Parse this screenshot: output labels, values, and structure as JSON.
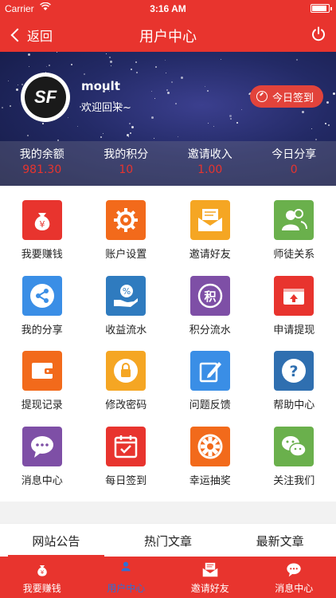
{
  "status": {
    "carrier": "Carrier",
    "time": "3:16 AM",
    "battery_level": 0.9
  },
  "nav": {
    "back_label": "返回",
    "title": "用户中心"
  },
  "profile": {
    "avatar_text": "SF",
    "username": "moult",
    "welcome": "欢迎回来~",
    "checkin_label": "今日签到"
  },
  "stats": [
    {
      "label": "我的余额",
      "value": "981.30"
    },
    {
      "label": "我的积分",
      "value": "10"
    },
    {
      "label": "邀请收入",
      "value": "1.00"
    },
    {
      "label": "今日分享",
      "value": "0"
    }
  ],
  "grid": [
    {
      "label": "我要赚钱",
      "icon": "money-bag-icon",
      "color": "#e8342e"
    },
    {
      "label": "账户设置",
      "icon": "gear-icon",
      "color": "#f26a1b"
    },
    {
      "label": "邀请好友",
      "icon": "envelope-icon",
      "color": "#f5a623"
    },
    {
      "label": "师徒关系",
      "icon": "users-icon",
      "color": "#6ab04c"
    },
    {
      "label": "我的分享",
      "icon": "share-icon",
      "color": "#3a8ee6"
    },
    {
      "label": "收益流水",
      "icon": "percent-hand-icon",
      "color": "#2f7bbf"
    },
    {
      "label": "积分流水",
      "icon": "points-icon",
      "color": "#7e4fa6"
    },
    {
      "label": "申请提现",
      "icon": "wallet-up-icon",
      "color": "#e8342e"
    },
    {
      "label": "提现记录",
      "icon": "wallet-icon",
      "color": "#f26a1b"
    },
    {
      "label": "修改密码",
      "icon": "lock-icon",
      "color": "#f5a623"
    },
    {
      "label": "问题反馈",
      "icon": "edit-icon",
      "color": "#3a8ee6"
    },
    {
      "label": "帮助中心",
      "icon": "help-icon",
      "color": "#2f6fb0"
    },
    {
      "label": "消息中心",
      "icon": "chat-icon",
      "color": "#7e4fa6"
    },
    {
      "label": "每日签到",
      "icon": "calendar-check-icon",
      "color": "#e8342e"
    },
    {
      "label": "幸运抽奖",
      "icon": "lottery-wheel-icon",
      "color": "#f26a1b"
    },
    {
      "label": "关注我们",
      "icon": "wechat-icon",
      "color": "#6ab04c"
    }
  ],
  "tabs": [
    {
      "label": "网站公告",
      "active": true
    },
    {
      "label": "热门文章",
      "active": false
    },
    {
      "label": "最新文章",
      "active": false
    }
  ],
  "bottom_nav": [
    {
      "label": "我要赚钱",
      "icon": "money-bag-icon",
      "active": false
    },
    {
      "label": "用户中心",
      "icon": "user-icon",
      "active": true
    },
    {
      "label": "邀请好友",
      "icon": "envelope-icon",
      "active": false
    },
    {
      "label": "消息中心",
      "icon": "chat-icon",
      "active": false
    }
  ]
}
